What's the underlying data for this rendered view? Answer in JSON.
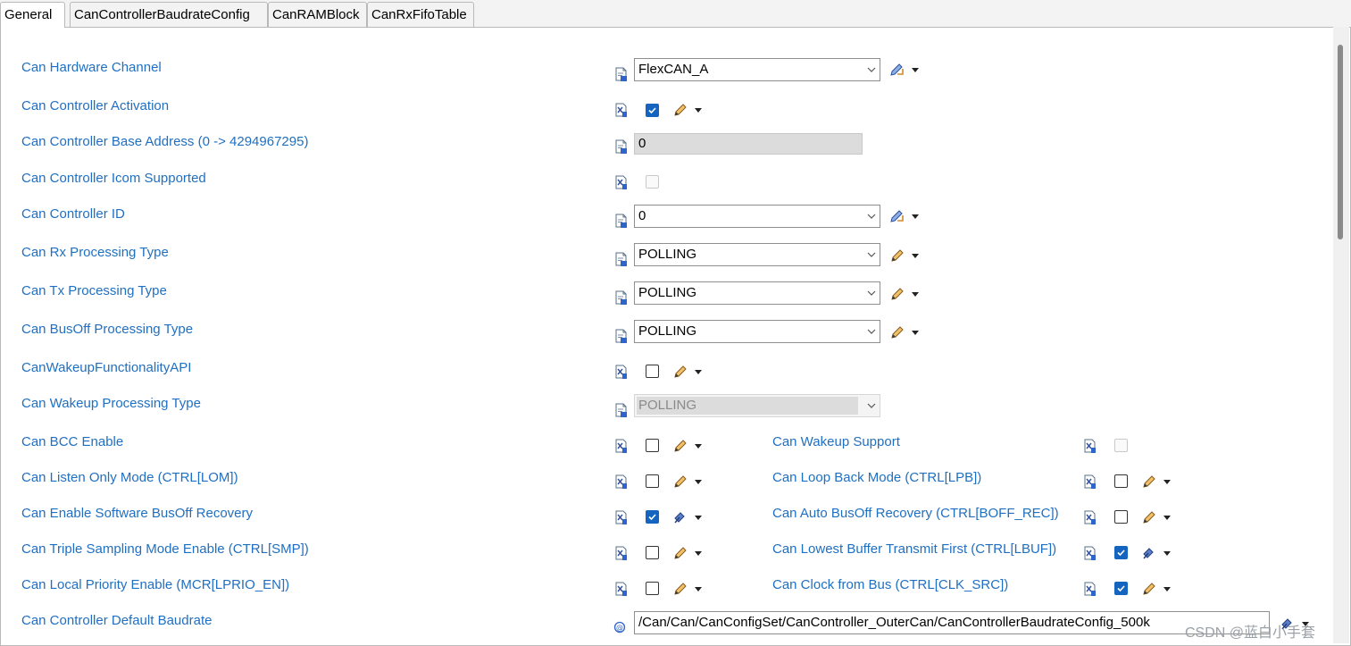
{
  "tabs": [
    {
      "label": "General",
      "active": true
    },
    {
      "label": "CanControllerBaudrateConfig",
      "active": false
    },
    {
      "label": "CanRAMBlock",
      "active": false
    },
    {
      "label": "CanRxFifoTable",
      "active": false
    }
  ],
  "left_rows": {
    "hardware_channel": {
      "label": "Can Hardware Channel",
      "value": "FlexCAN_A"
    },
    "controller_activation": {
      "label": "Can Controller Activation",
      "checked": true
    },
    "base_address": {
      "label": "Can Controller Base Address (0 -> 4294967295)",
      "value": "0"
    },
    "icom_supported": {
      "label": "Can Controller Icom Supported",
      "checked": false
    },
    "controller_id": {
      "label": "Can Controller ID",
      "value": "0"
    },
    "rx_processing": {
      "label": "Can Rx Processing Type",
      "value": "POLLING"
    },
    "tx_processing": {
      "label": "Can Tx Processing Type",
      "value": "POLLING"
    },
    "busoff_processing": {
      "label": "Can BusOff Processing Type",
      "value": "POLLING"
    },
    "wakeup_api": {
      "label": "CanWakeupFunctionalityAPI",
      "checked": false
    },
    "wakeup_processing": {
      "label": "Can Wakeup Processing Type",
      "value": "POLLING"
    },
    "bcc_enable": {
      "label": "Can BCC Enable",
      "checked": false
    },
    "listen_only": {
      "label": "Can Listen Only Mode (CTRL[LOM])",
      "checked": false
    },
    "sw_busoff_recovery": {
      "label": "Can Enable Software BusOff Recovery",
      "checked": true
    },
    "triple_sampling": {
      "label": "Can Triple Sampling Mode Enable (CTRL[SMP])",
      "checked": false
    },
    "local_priority": {
      "label": "Can Local Priority Enable (MCR[LPRIO_EN])",
      "checked": false
    },
    "default_baudrate": {
      "label": "Can Controller Default Baudrate",
      "value": "/Can/Can/CanConfigSet/CanController_OuterCan/CanControllerBaudrateConfig_500k"
    }
  },
  "right_rows": {
    "wakeup_support": {
      "label": "Can Wakeup Support",
      "checked": false
    },
    "loop_back": {
      "label": "Can Loop Back Mode (CTRL[LPB])",
      "checked": false
    },
    "auto_busoff": {
      "label": "Can Auto BusOff Recovery (CTRL[BOFF_REC])",
      "checked": false
    },
    "lowest_buffer": {
      "label": "Can Lowest Buffer Transmit First (CTRL[LBUF])",
      "checked": true
    },
    "clock_from_bus": {
      "label": "Can Clock from Bus (CTRL[CLK_SRC])",
      "checked": true
    }
  },
  "watermark": "CSDN @蓝白小手套",
  "colors": {
    "label": "#1f6fc2",
    "checkbox": "#1565c0",
    "pencil": "#e2a23a"
  }
}
